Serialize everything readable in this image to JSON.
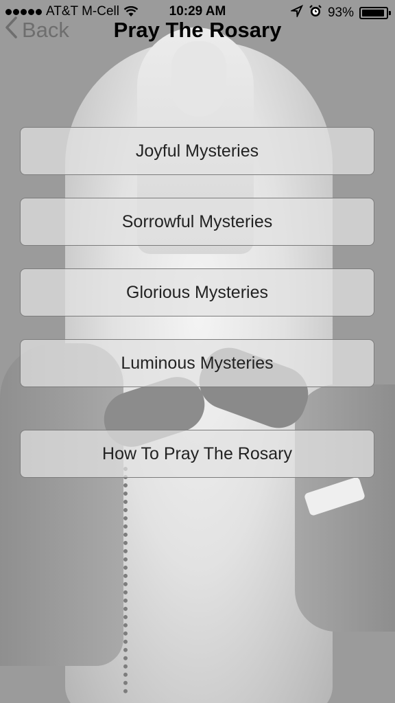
{
  "status_bar": {
    "carrier": "AT&T M-Cell",
    "time": "10:29 AM",
    "battery_percent": "93%",
    "battery_level": 0.93,
    "signal_bars": 5,
    "icons": [
      "signal-icon",
      "wifi-icon",
      "location-icon",
      "alarm-icon",
      "battery-icon"
    ]
  },
  "nav": {
    "back_label": "Back",
    "title": "Pray The Rosary",
    "back_icon": "chevron-left-icon"
  },
  "menu": {
    "items": [
      {
        "label": "Joyful Mysteries"
      },
      {
        "label": "Sorrowful Mysteries"
      },
      {
        "label": "Glorious Mysteries"
      },
      {
        "label": "Luminous Mysteries"
      },
      {
        "label": "How To Pray The Rosary"
      }
    ]
  },
  "colors": {
    "background": "#9b9b9b",
    "button_fill": "#e2e2e2",
    "button_border": "#7b7b7b",
    "back_text": "#6e6e6e"
  }
}
